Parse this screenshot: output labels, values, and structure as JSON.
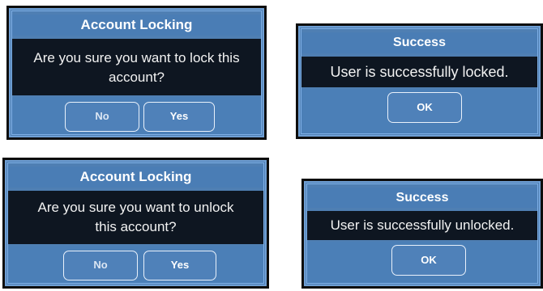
{
  "dialogs": {
    "lock_confirm": {
      "title": "Account Locking",
      "message_line1": "Are you sure you want to lock this",
      "message_line2": "account?",
      "no_label": "No",
      "yes_label": "Yes"
    },
    "lock_success": {
      "title": "Success",
      "message": "User is successfully locked.",
      "ok_label": "OK"
    },
    "unlock_confirm": {
      "title": "Account Locking",
      "message_line1": "Are you sure you want to unlock",
      "message_line2": "this account?",
      "no_label": "No",
      "yes_label": "Yes"
    },
    "unlock_success": {
      "title": "Success",
      "message": "User is successfully unlocked.",
      "ok_label": "OK"
    }
  },
  "colors": {
    "dialog_blue": "#4f7fb3",
    "message_background": "#0e1621",
    "border": "#0d0d0d",
    "text": "#ffffff"
  }
}
